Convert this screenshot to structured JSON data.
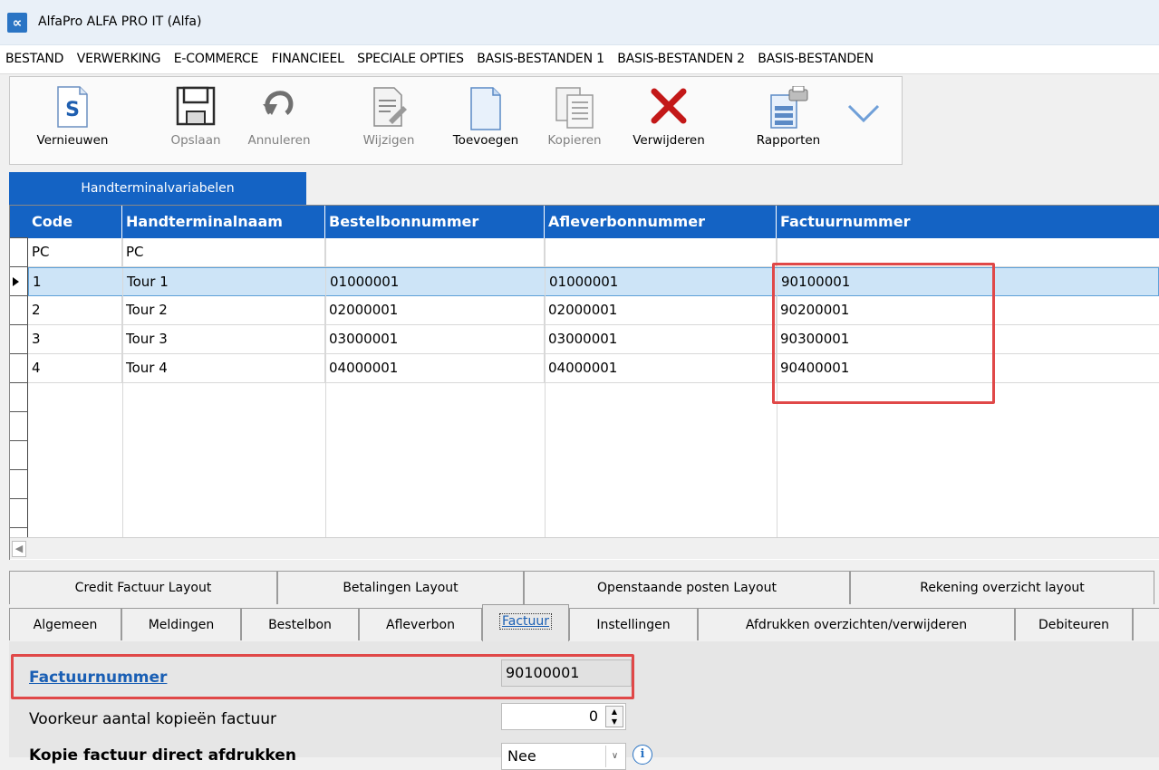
{
  "window": {
    "title": "AlfaPro ALFA PRO IT (Alfa)",
    "icon": "alpha-logo-icon",
    "icon_glyph": "∝"
  },
  "menu": [
    "BESTAND",
    "VERWERKING",
    "E-COMMERCE",
    "FINANCIEEL",
    "SPECIALE OPTIES",
    "BASIS-BESTANDEN 1",
    "BASIS-BESTANDEN 2",
    "BASIS-BESTANDEN"
  ],
  "toolbar": {
    "refresh": "Vernieuwen",
    "save": "Opslaan",
    "cancel": "Annuleren",
    "edit": "Wijzigen",
    "add": "Toevoegen",
    "copy": "Kopieren",
    "delete": "Verwijderen",
    "reports": "Rapporten"
  },
  "grid": {
    "tab": "Handterminalvariabelen",
    "columns": [
      "Code",
      "Handterminalnaam",
      "Bestelbonnummer",
      "Afleverbonnummer",
      "Factuurnummer"
    ],
    "rows": [
      [
        "PC",
        "PC",
        "",
        "",
        ""
      ],
      [
        "1",
        "Tour 1",
        "01000001",
        "01000001",
        "90100001"
      ],
      [
        "2",
        "Tour 2",
        "02000001",
        "02000001",
        "90200001"
      ],
      [
        "3",
        "Tour 3",
        "03000001",
        "03000001",
        "90300001"
      ],
      [
        "4",
        "Tour 4",
        "04000001",
        "04000001",
        "90400001"
      ]
    ],
    "selected_row": 1
  },
  "tabs_top": [
    "Credit Factuur Layout",
    "Betalingen Layout",
    "Openstaande posten Layout",
    "Rekening overzicht layout"
  ],
  "tabs_bottom": [
    "Algemeen",
    "Meldingen",
    "Bestelbon",
    "Afleverbon",
    "Factuur",
    "Instellingen",
    "Afdrukken overzichten/verwijderen",
    "Debiteuren"
  ],
  "active_tab": "Factuur",
  "form": {
    "invoice_label": "Factuurnummer",
    "invoice_value": "90100001",
    "copies_label": "Voorkeur aantal kopieën factuur",
    "copies_value": "0",
    "print_label": "Kopie factuur direct afdrukken",
    "print_value": "Nee"
  },
  "colors": {
    "accent": "#1463c4",
    "highlight": "#e04848",
    "selected_row": "#cde4f7"
  }
}
